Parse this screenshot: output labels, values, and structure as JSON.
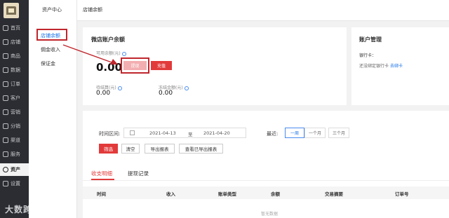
{
  "nav": {
    "items": [
      {
        "label": "首页",
        "icon": "home-icon"
      },
      {
        "label": "店铺",
        "icon": "store-icon"
      },
      {
        "label": "商品",
        "icon": "goods-icon"
      },
      {
        "label": "数据",
        "icon": "data-icon"
      },
      {
        "label": "订单",
        "icon": "order-icon"
      },
      {
        "label": "客户",
        "icon": "customer-icon"
      },
      {
        "label": "营销",
        "icon": "marketing-icon"
      },
      {
        "label": "分销",
        "icon": "distribution-icon"
      },
      {
        "label": "渠道",
        "icon": "channel-icon"
      },
      {
        "label": "服务",
        "icon": "service-icon"
      },
      {
        "label": "资产",
        "icon": "asset-icon"
      },
      {
        "label": "设置",
        "icon": "settings-icon"
      }
    ]
  },
  "subnav": {
    "title": "资产中心",
    "items": [
      "店铺余额",
      "佣金收入",
      "保证金"
    ]
  },
  "topbar": {
    "title": "店铺余额"
  },
  "balance": {
    "title": "微店账户余额",
    "available_label": "可用余额(元)",
    "available_value": "0.00",
    "withdraw_label": "提现",
    "recharge_label": "充值",
    "pending_label": "待结算(元)",
    "pending_value": "0.00",
    "frozen_label": "冻结金额(元)",
    "frozen_value": "0.00"
  },
  "account": {
    "title": "账户管理",
    "bank_label": "银行卡：",
    "bank_text": "还没绑定银行卡",
    "bind_link": "去绑卡"
  },
  "filter": {
    "range_label": "时间区间:",
    "date_from": "2021-04-13",
    "date_sep": "至",
    "date_to": "2021-04-20",
    "recent_label": "最近:",
    "recent_options": [
      "一周",
      "一个月",
      "三个月"
    ],
    "buttons": [
      "筛选",
      "清空",
      "导出报表",
      "查看已导出报表"
    ]
  },
  "tabs": [
    "收支明细",
    "提现记录"
  ],
  "table": {
    "columns": [
      "时间",
      "收入",
      "账单类型",
      "余额",
      "交易摘要",
      "订单号"
    ],
    "empty_text": "暂无数据"
  },
  "watermark": "大数跨境",
  "colors": {
    "accent_red": "#e23a3a",
    "link_blue": "#1a73e8",
    "nav_bg": "#2b2d33"
  }
}
